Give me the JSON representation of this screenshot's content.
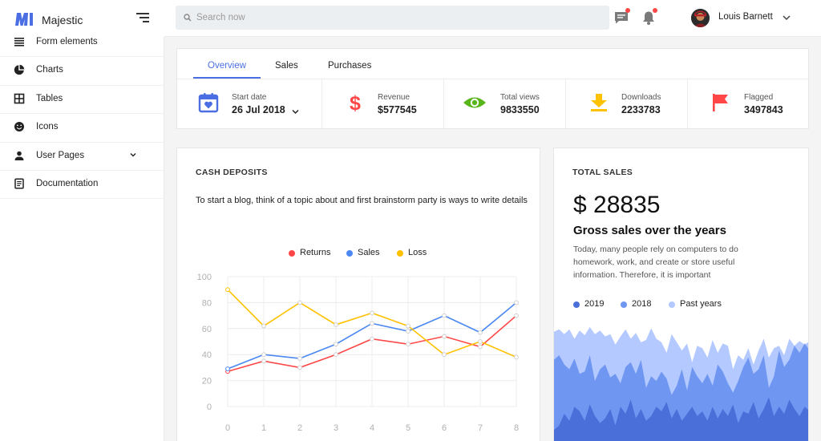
{
  "brand": {
    "name": "Majestic",
    "color": "#4b6fe3"
  },
  "sidebar": {
    "items": [
      {
        "label": "Form elements",
        "icon": "list-icon"
      },
      {
        "label": "Charts",
        "icon": "pie-chart-icon"
      },
      {
        "label": "Tables",
        "icon": "grid-icon"
      },
      {
        "label": "Icons",
        "icon": "emoji-icon"
      },
      {
        "label": "User Pages",
        "icon": "person-icon",
        "expandable": true
      },
      {
        "label": "Documentation",
        "icon": "document-icon"
      }
    ]
  },
  "header": {
    "search_placeholder": "Search now",
    "user_name": "Louis Barnett",
    "message_icon": "message-icon",
    "notification_icon": "bell-icon"
  },
  "overview": {
    "tabs": [
      {
        "label": "Overview",
        "active": true
      },
      {
        "label": "Sales",
        "active": false
      },
      {
        "label": "Purchases",
        "active": false
      }
    ],
    "stats": [
      {
        "label": "Start date",
        "value": "26 Jul 2018",
        "icon": "calendar-icon",
        "color": "#4b6fe3"
      },
      {
        "label": "Revenue",
        "value": "$577545",
        "icon": "dollar-icon",
        "color": "#ff4747"
      },
      {
        "label": "Total views",
        "value": "9833550",
        "icon": "eye-icon",
        "color": "#57b519"
      },
      {
        "label": "Downloads",
        "value": "2233783",
        "icon": "download-icon",
        "color": "#ffc100"
      },
      {
        "label": "Flagged",
        "value": "3497843",
        "icon": "flag-icon",
        "color": "#ff4747"
      }
    ]
  },
  "cash_deposits": {
    "title": "CASH DEPOSITS",
    "description": "To start a blog, think of a topic about and first brainstorm party is ways to write details"
  },
  "total_sales": {
    "title": "TOTAL SALES",
    "total": "$ 28835",
    "subtitle": "Gross sales over the years",
    "description": "Today, many people rely on computers to do homework, work, and create or store useful information. Therefore, it is important",
    "legend": [
      {
        "name": "2019",
        "color": "#4a6fd9"
      },
      {
        "name": "2018",
        "color": "#6f97f2"
      },
      {
        "name": "Past years",
        "color": "#b3c9ff"
      }
    ]
  },
  "chart_data": [
    {
      "type": "line",
      "x": [
        0,
        1,
        2,
        3,
        4,
        5,
        6,
        7,
        8
      ],
      "series": [
        {
          "name": "Returns",
          "color": "#ff4747",
          "values": [
            27,
            35,
            30,
            40,
            52,
            48,
            54,
            46,
            70
          ]
        },
        {
          "name": "Sales",
          "color": "#4b88f2",
          "values": [
            29,
            40,
            37,
            48,
            64,
            58,
            70,
            57,
            80
          ]
        },
        {
          "name": "Loss",
          "color": "#ffc100",
          "values": [
            90,
            62,
            80,
            63,
            72,
            62,
            40,
            50,
            38
          ]
        }
      ],
      "ylim": [
        0,
        100
      ],
      "yticks": [
        0,
        20,
        40,
        60,
        80,
        100
      ],
      "grid": true,
      "legend": "top-center"
    },
    {
      "type": "area",
      "x": [
        0,
        1,
        2,
        3,
        4,
        5,
        6,
        7,
        8,
        9,
        10,
        11,
        12,
        13,
        14,
        15,
        16,
        17,
        18,
        19,
        20,
        21,
        22,
        23,
        24,
        25,
        26,
        27,
        28,
        29,
        30,
        31,
        32,
        33,
        34,
        35,
        36,
        37,
        38,
        39,
        40,
        41,
        42,
        43,
        44,
        45,
        46,
        47,
        48,
        49,
        50
      ],
      "series": [
        {
          "name": "Past years",
          "color": "#b3c9ff",
          "values": [
            94,
            96,
            92,
            96,
            88,
            95,
            91,
            98,
            92,
            95,
            90,
            92,
            83,
            90,
            96,
            88,
            93,
            85,
            87,
            97,
            88,
            85,
            76,
            92,
            85,
            78,
            84,
            68,
            82,
            80,
            72,
            87,
            76,
            84,
            82,
            62,
            74,
            70,
            80,
            66,
            78,
            88,
            72,
            80,
            82,
            74,
            88,
            82,
            86,
            83,
            86
          ]
        },
        {
          "name": "2018",
          "color": "#6f97f2",
          "values": [
            70,
            74,
            66,
            62,
            71,
            58,
            60,
            74,
            52,
            62,
            66,
            55,
            58,
            50,
            64,
            68,
            58,
            70,
            46,
            56,
            52,
            60,
            54,
            40,
            48,
            62,
            44,
            64,
            56,
            50,
            58,
            48,
            66,
            60,
            50,
            42,
            52,
            64,
            72,
            58,
            62,
            74,
            46,
            56,
            78,
            64,
            70,
            82,
            76,
            84,
            78
          ]
        },
        {
          "name": "2019",
          "color": "#4a6fd9",
          "values": [
            10,
            14,
            24,
            18,
            30,
            26,
            18,
            32,
            22,
            16,
            20,
            28,
            14,
            30,
            24,
            36,
            20,
            28,
            18,
            22,
            30,
            26,
            34,
            20,
            28,
            18,
            24,
            30,
            22,
            26,
            18,
            30,
            20,
            28,
            22,
            32,
            16,
            26,
            24,
            34,
            20,
            28,
            38,
            22,
            30,
            24,
            36,
            28,
            22,
            30,
            26
          ]
        }
      ],
      "ylim": [
        0,
        100
      ]
    }
  ]
}
